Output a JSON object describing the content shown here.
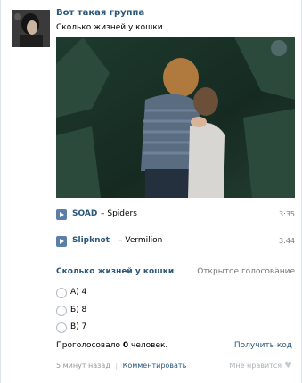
{
  "post": {
    "group_name": "Вот такая группа",
    "text": "Сколько жизней у кошки"
  },
  "tracks": [
    {
      "artist": "SOAD",
      "dash": "–",
      "title": "Spiders",
      "duration": "3:35"
    },
    {
      "artist": "Slipknot",
      "dash": "–",
      "title": "Vermilion",
      "duration": "3:44"
    }
  ],
  "poll": {
    "question": "Сколько жизней у кошки",
    "type": "Открытое голосование",
    "options": [
      "А) 4",
      "Б) 8",
      "В) 7"
    ],
    "voted_prefix": "Проголосовало",
    "voted_count": "0",
    "voted_suffix": "человек.",
    "get_code": "Получить код"
  },
  "meta": {
    "time": "5 минут назад",
    "separator": "|",
    "comment": "Комментировать",
    "like": "Мне нравится"
  },
  "colors": {
    "link": "#2b587a",
    "play": "#5b7fa6"
  },
  "icons": {
    "play": "play-icon",
    "heart": "heart-icon"
  }
}
